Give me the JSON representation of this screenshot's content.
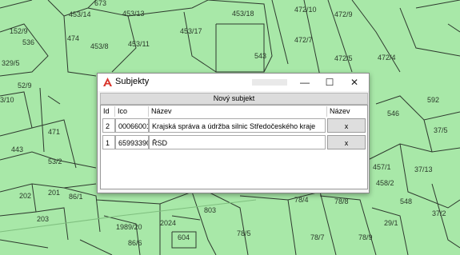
{
  "map": {
    "parcel_labels": [
      "673",
      "453/14",
      "453/13",
      "453/18",
      "472/10",
      "472/9",
      "474",
      "453/17",
      "472/7",
      "152/9",
      "536",
      "453/8",
      "453/11",
      "329/5",
      "543",
      "472/4",
      "52/9",
      "453/5",
      "3/10",
      "471",
      "546",
      "592",
      "37/5",
      "443",
      "53/2",
      "457/1",
      "37/13",
      "202",
      "201",
      "86/1",
      "78/4",
      "78/8",
      "458/2",
      "548",
      "203",
      "803",
      "1989/20",
      "2024",
      "604",
      "78/7",
      "78/5",
      "29/1",
      "78/9",
      "86/6",
      "37/2",
      "37/7",
      "1",
      "18"
    ]
  },
  "dialog": {
    "title": "Subjekty",
    "controls": {
      "minimize": "—",
      "maximize": "☐",
      "close": "✕"
    },
    "new_subject_label": "Nový subjekt",
    "columns": {
      "id": "Id",
      "ico": "Ico",
      "name": "Název",
      "action": "Název"
    },
    "rows": [
      {
        "id": "2",
        "ico": "00066001",
        "name": "Krajská správa a údržba silnic Středočeského kraje",
        "action": "x"
      },
      {
        "id": "1",
        "ico": "65993390",
        "name": "ŘSD",
        "action": "x"
      }
    ]
  },
  "colors": {
    "map_fill": "#a8e8a8",
    "map_line": "#2e3a2e",
    "accent_logo": "#d9342b"
  }
}
